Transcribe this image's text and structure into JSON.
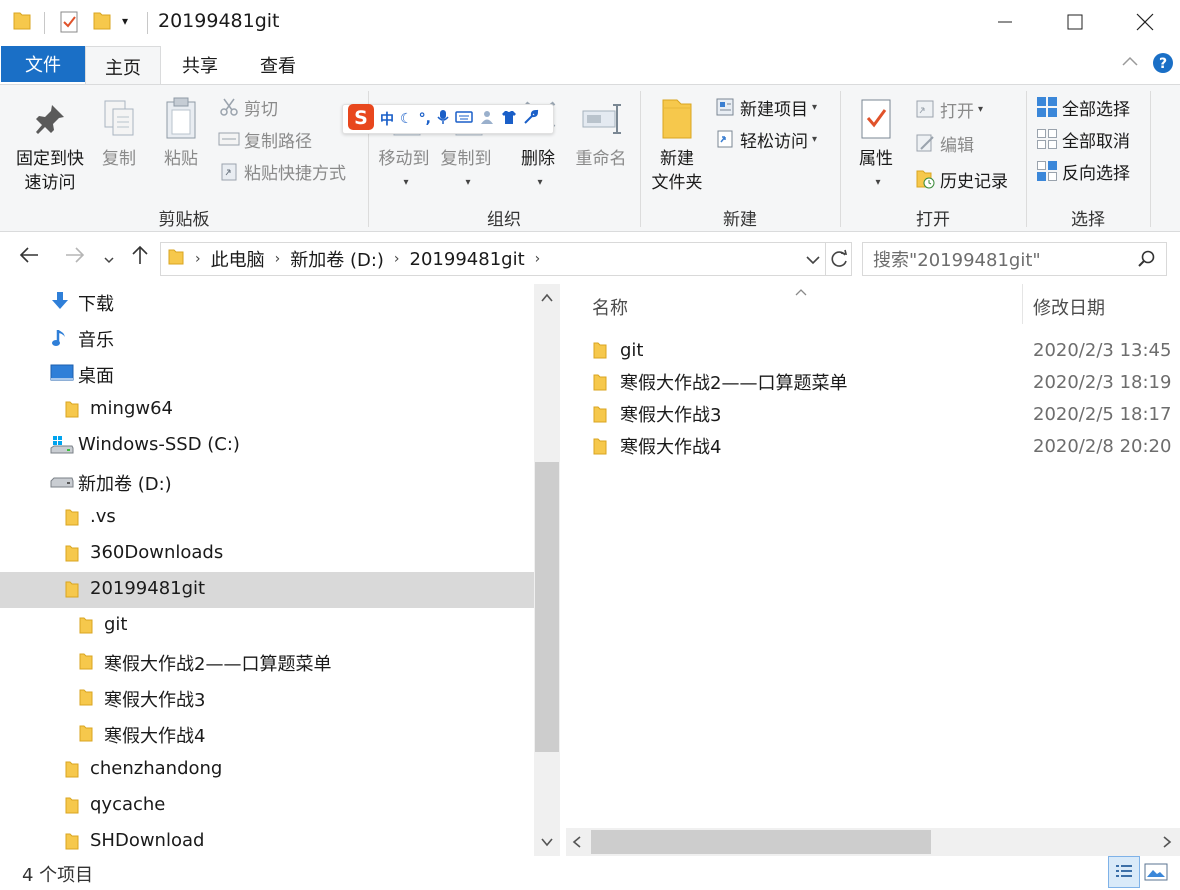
{
  "window": {
    "title": "20199481git"
  },
  "tabs": {
    "file": "文件",
    "home": "主页",
    "share": "共享",
    "view": "查看"
  },
  "ribbon": {
    "clipboard": {
      "label": "剪贴板",
      "pin_line1": "固定到快",
      "pin_line2": "速访问",
      "copy": "复制",
      "paste": "粘贴",
      "cut": "剪切",
      "copy_path": "复制路径",
      "paste_shortcut": "粘贴快捷方式"
    },
    "organize": {
      "label": "组织",
      "move_to": "移动到",
      "copy_to": "复制到",
      "delete": "删除",
      "rename": "重命名"
    },
    "new": {
      "label": "新建",
      "new_folder_line1": "新建",
      "new_folder_line2": "文件夹",
      "new_item": "新建项目",
      "easy_access": "轻松访问"
    },
    "open": {
      "label": "打开",
      "properties": "属性",
      "open": "打开",
      "edit": "编辑",
      "history": "历史记录"
    },
    "select": {
      "label": "选择",
      "select_all": "全部选择",
      "select_none": "全部取消",
      "invert": "反向选择"
    }
  },
  "ime": {
    "mode": "中",
    "punct": "°,"
  },
  "address": {
    "crumbs": [
      "此电脑",
      "新加卷 (D:)",
      "20199481git"
    ],
    "search_placeholder": "搜索\"20199481git\""
  },
  "nav": [
    {
      "label": "下载",
      "icon": "download-icon",
      "indent": 0
    },
    {
      "label": "音乐",
      "icon": "music-icon",
      "indent": 0
    },
    {
      "label": "桌面",
      "icon": "desktop-icon",
      "indent": 0
    },
    {
      "label": "mingw64",
      "icon": "folder-icon",
      "indent": 1
    },
    {
      "label": "Windows-SSD (C:)",
      "icon": "drive-c-icon",
      "indent": 0
    },
    {
      "label": "新加卷 (D:)",
      "icon": "drive-icon",
      "indent": 0
    },
    {
      "label": ".vs",
      "icon": "folder-icon",
      "indent": 1
    },
    {
      "label": "360Downloads",
      "icon": "folder-icon",
      "indent": 1
    },
    {
      "label": "20199481git",
      "icon": "folder-icon",
      "indent": 1,
      "selected": true
    },
    {
      "label": "git",
      "icon": "folder-icon",
      "indent": 2
    },
    {
      "label": "寒假大作战2——口算题菜单",
      "icon": "folder-icon",
      "indent": 2
    },
    {
      "label": "寒假大作战3",
      "icon": "folder-icon",
      "indent": 2
    },
    {
      "label": "寒假大作战4",
      "icon": "folder-icon",
      "indent": 2
    },
    {
      "label": "chenzhandong",
      "icon": "folder-icon",
      "indent": 1
    },
    {
      "label": "qycache",
      "icon": "folder-icon",
      "indent": 1
    },
    {
      "label": "SHDownload",
      "icon": "folder-icon",
      "indent": 1
    }
  ],
  "content": {
    "col_name": "名称",
    "col_date": "修改日期",
    "rows": [
      {
        "name": "git",
        "date": "2020/2/3 13:45"
      },
      {
        "name": "寒假大作战2——口算题菜单",
        "date": "2020/2/3 18:19"
      },
      {
        "name": "寒假大作战3",
        "date": "2020/2/5 18:17"
      },
      {
        "name": "寒假大作战4",
        "date": "2020/2/8 20:20"
      }
    ]
  },
  "status": {
    "count": "4 个项目"
  },
  "colors": {
    "file_tab": "#1a6fc6",
    "folder": "#f6c84c",
    "selection": "#d9d9d9",
    "help": "#1a6fc6"
  }
}
